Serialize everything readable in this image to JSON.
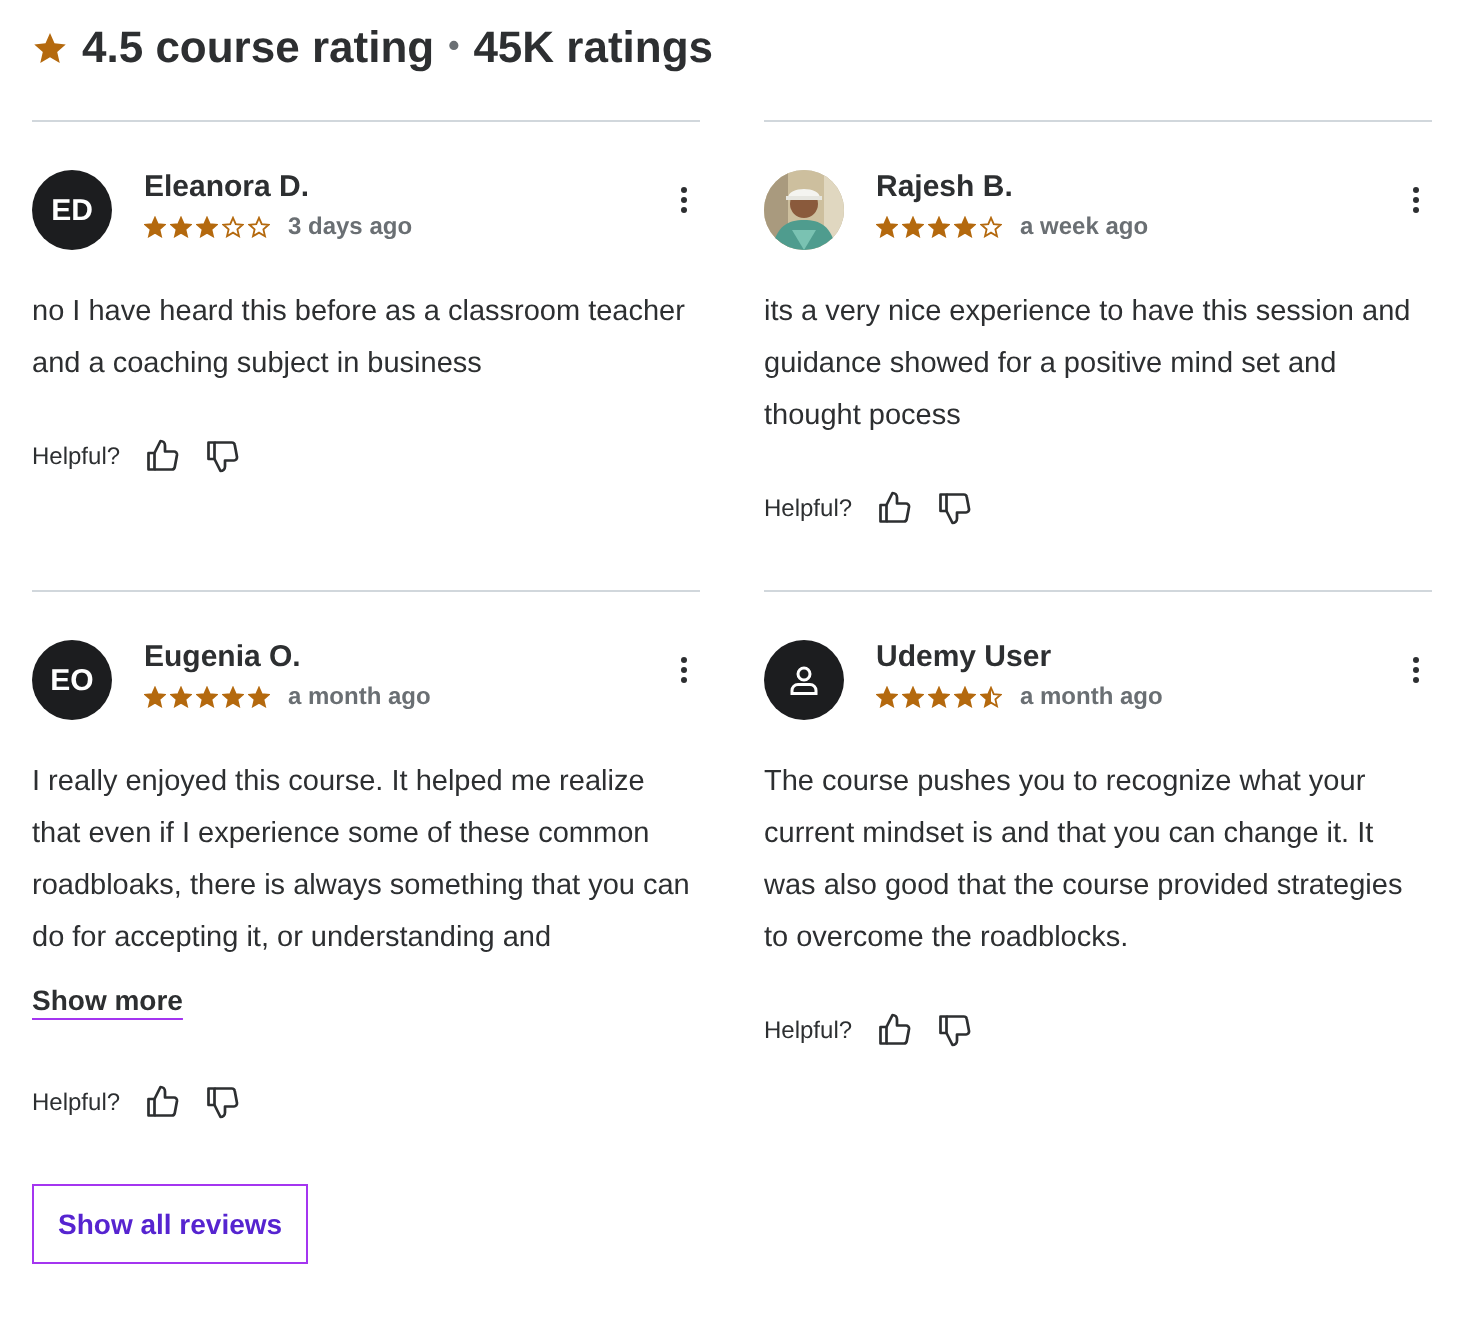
{
  "summary": {
    "rating": "4.5 course rating",
    "separator": "•",
    "count": "45K ratings"
  },
  "reviews": [
    {
      "name": "Eleanora D.",
      "avatar": {
        "kind": "initials",
        "text": "ED"
      },
      "stars": 3,
      "time": "3 days ago",
      "text": "no I have heard this before as a classroom teacher and a coaching subject in business",
      "helpful": "Helpful?"
    },
    {
      "name": "Rajesh B.",
      "stars": 4,
      "time": "a week ago",
      "text": "its a very nice experience to have this session and guidance showed for a positive mind set and thought pocess",
      "helpful": "Helpful?"
    },
    {
      "name": "Eugenia O.",
      "avatar": {
        "kind": "initials",
        "text": "EO"
      },
      "stars": 5,
      "time": "a month ago",
      "text": "I really enjoyed this course. It helped me realize that even if I experience some of these common roadbloaks, there is always something that you can do for accepting it, or understanding and",
      "show_more": "Show more",
      "helpful": "Helpful?"
    },
    {
      "name": "Udemy User",
      "avatar": {
        "kind": "icon"
      },
      "stars": 4.5,
      "time": "a month ago",
      "text": "The course pushes you to recognize what your current mindset is and that you can change it. It was also good that the course provided strategies to overcome the roadblocks.",
      "helpful": "Helpful?"
    }
  ],
  "show_all": "Show all reviews"
}
